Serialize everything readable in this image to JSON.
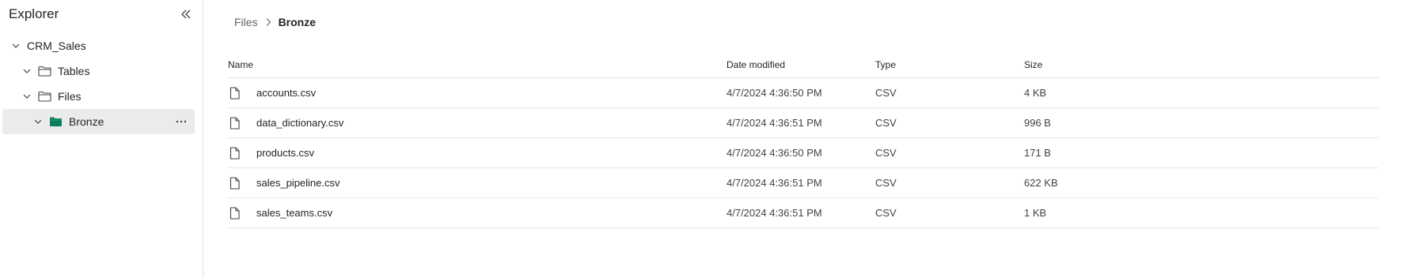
{
  "sidebar": {
    "title": "Explorer",
    "tree": {
      "root": {
        "label": "CRM_Sales"
      },
      "tables": {
        "label": "Tables"
      },
      "files": {
        "label": "Files"
      },
      "bronze": {
        "label": "Bronze",
        "folder_color": "#0f7b5f"
      }
    }
  },
  "breadcrumb": {
    "parent": "Files",
    "current": "Bronze"
  },
  "table": {
    "columns": {
      "name": "Name",
      "date": "Date modified",
      "type": "Type",
      "size": "Size"
    },
    "rows": [
      {
        "name": "accounts.csv",
        "date": "4/7/2024 4:36:50 PM",
        "type": "CSV",
        "size": "4 KB"
      },
      {
        "name": "data_dictionary.csv",
        "date": "4/7/2024 4:36:51 PM",
        "type": "CSV",
        "size": "996 B"
      },
      {
        "name": "products.csv",
        "date": "4/7/2024 4:36:50 PM",
        "type": "CSV",
        "size": "171 B"
      },
      {
        "name": "sales_pipeline.csv",
        "date": "4/7/2024 4:36:51 PM",
        "type": "CSV",
        "size": "622 KB"
      },
      {
        "name": "sales_teams.csv",
        "date": "4/7/2024 4:36:51 PM",
        "type": "CSV",
        "size": "1 KB"
      }
    ]
  },
  "icons": {
    "collapse": "double-chevron-left-icon",
    "expand": "chevron-down-icon",
    "folder": "folder-icon",
    "file": "file-icon",
    "more": "more-horizontal-icon",
    "separator": "chevron-right-icon"
  }
}
